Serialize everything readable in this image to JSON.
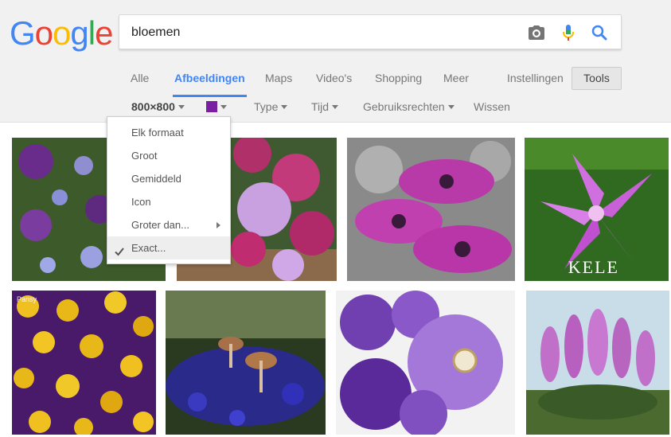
{
  "logo": {
    "text": "Google",
    "letters": [
      "G",
      "o",
      "o",
      "g",
      "l",
      "e"
    ],
    "colors": [
      "#4285f4",
      "#ea4335",
      "#fbbc05",
      "#4285f4",
      "#34a853",
      "#ea4335"
    ]
  },
  "search": {
    "query": "bloemen",
    "icons": [
      "camera-icon",
      "microphone-icon",
      "search-icon"
    ]
  },
  "tabs": [
    {
      "label": "Alle",
      "active": false
    },
    {
      "label": "Afbeeldingen",
      "active": true
    },
    {
      "label": "Maps",
      "active": false
    },
    {
      "label": "Video's",
      "active": false
    },
    {
      "label": "Shopping",
      "active": false
    },
    {
      "label": "Meer",
      "active": false
    }
  ],
  "settings_label": "Instellingen",
  "tools_label": "Tools",
  "filters": {
    "size": "800×800",
    "color": "#7b1fa2",
    "type": "Type",
    "time": "Tijd",
    "usage": "Gebruiksrechten",
    "clear": "Wissen"
  },
  "size_menu": {
    "items": [
      "Elk formaat",
      "Groot",
      "Gemiddeld",
      "Icon",
      "Groter dan...",
      "Exact..."
    ],
    "selected": "Exact..."
  },
  "results": [
    {
      "watermark": ""
    },
    {
      "watermark": ""
    },
    {
      "watermark": ""
    },
    {
      "watermark": "KELE"
    },
    {
      "watermark": "Pansy"
    },
    {
      "watermark": ""
    },
    {
      "watermark": ""
    },
    {
      "watermark": ""
    }
  ]
}
